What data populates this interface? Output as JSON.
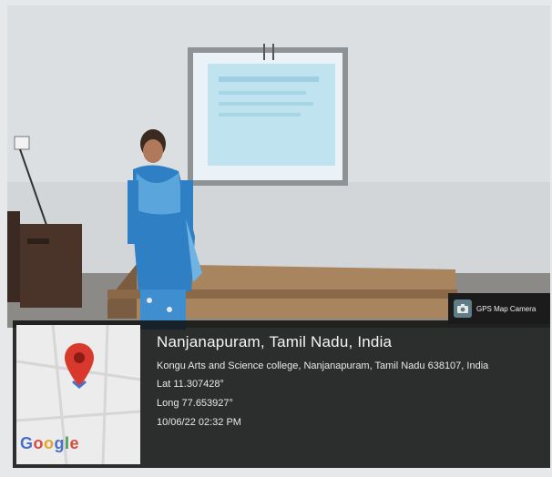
{
  "badge": {
    "label": "GPS Map Camera",
    "icon": "camera-icon"
  },
  "location": {
    "place": "Nanjanapuram, Tamil Nadu, India",
    "address": "Kongu Arts and Science college, Nanjanapuram, Tamil Nadu 638107, India",
    "lat": "Lat 11.307428°",
    "long": "Long 77.653927°",
    "datetime": "10/06/22 02:32 PM"
  },
  "map": {
    "logo_text": "Google",
    "pin_color": "#d9382d"
  }
}
